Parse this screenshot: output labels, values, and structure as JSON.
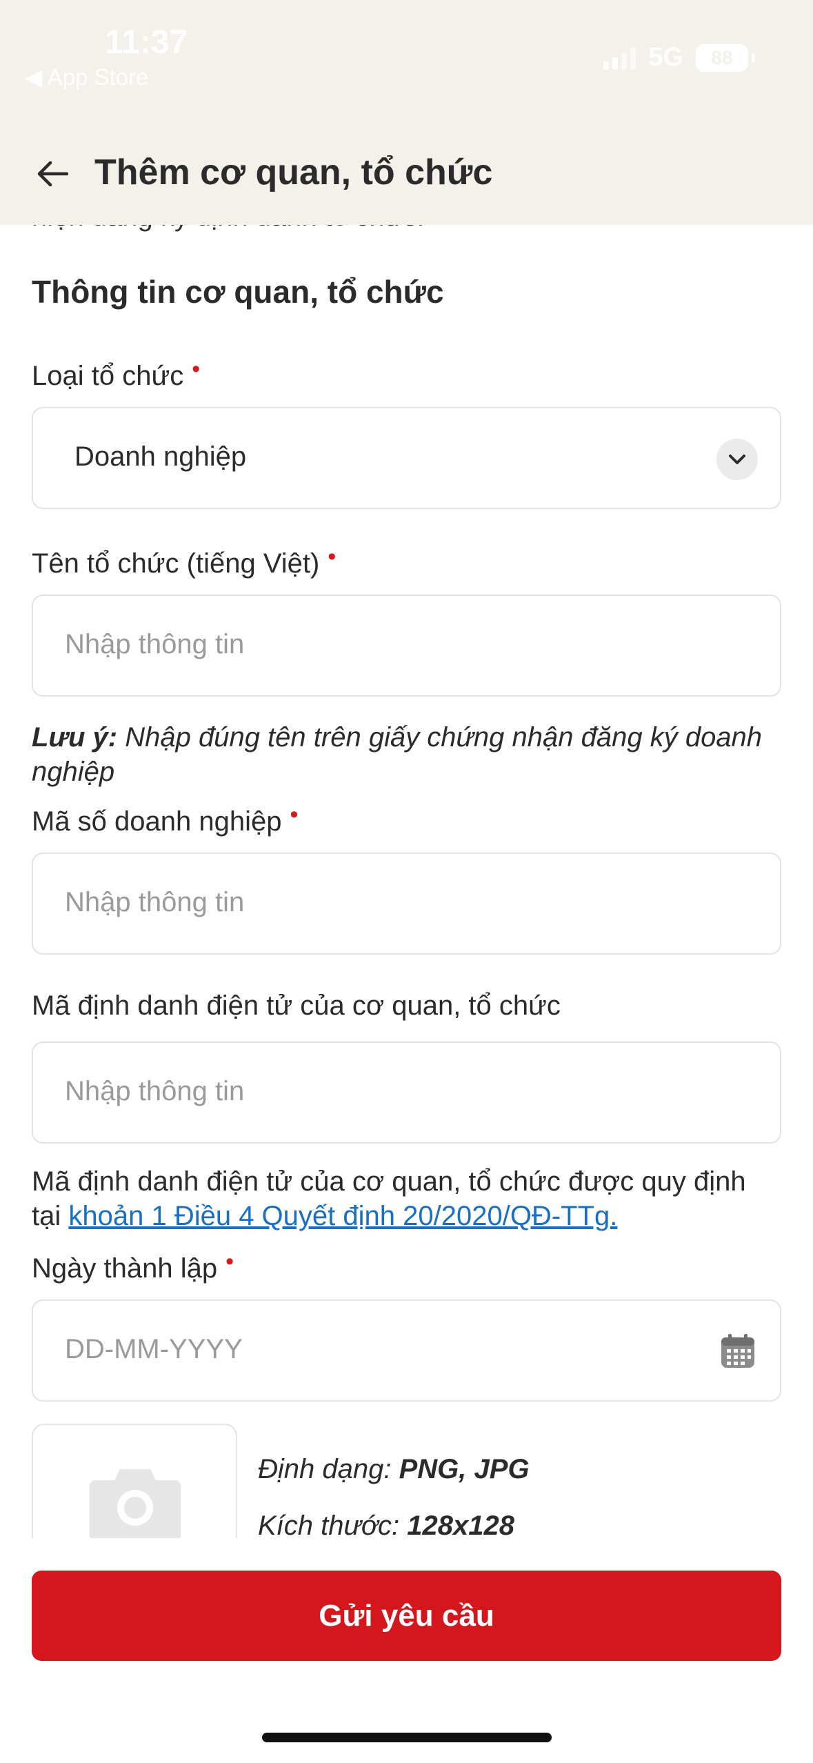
{
  "status_bar": {
    "time": "11:37",
    "back_app": "◀ App Store",
    "network": "5G",
    "battery": "88"
  },
  "header": {
    "title": "Thêm cơ quan, tổ chức"
  },
  "content": {
    "cut_text": "hiện đăng ký định danh tổ chức.",
    "section_title": "Thông tin cơ quan, tổ chức"
  },
  "fields": {
    "org_type": {
      "label": "Loại tổ chức",
      "value": "Doanh nghiệp"
    },
    "org_name": {
      "label": "Tên tổ chức (tiếng Việt)",
      "placeholder": "Nhập thông tin"
    },
    "note": {
      "prefix": "Lưu ý:",
      "text": " Nhập đúng tên trên giấy chứng nhận đăng ký doanh nghiệp"
    },
    "business_code": {
      "label": "Mã số doanh nghiệp",
      "placeholder": "Nhập thông tin"
    },
    "eid_code": {
      "label": "Mã định danh điện tử của cơ quan, tổ chức",
      "placeholder": "Nhập thông tin"
    },
    "eid_help": {
      "text": "Mã định danh điện tử của cơ quan, tổ chức được quy định tại ",
      "link": "khoản 1 Điều 4 Quyết định 20/2020/QĐ-TTg."
    },
    "founding_date": {
      "label": "Ngày thành lập",
      "placeholder": "DD-MM-YYYY"
    },
    "required_mark": "•"
  },
  "upload": {
    "format_label": "Định dạng:",
    "format_value": "PNG, JPG",
    "size_label": "Kích thước:",
    "size_value": "128x128"
  },
  "submit": {
    "label": "Gửi yêu cầu"
  },
  "colors": {
    "accent": "#d4161d",
    "link": "#1a6fc4",
    "header_bg": "#f4f0ea"
  }
}
